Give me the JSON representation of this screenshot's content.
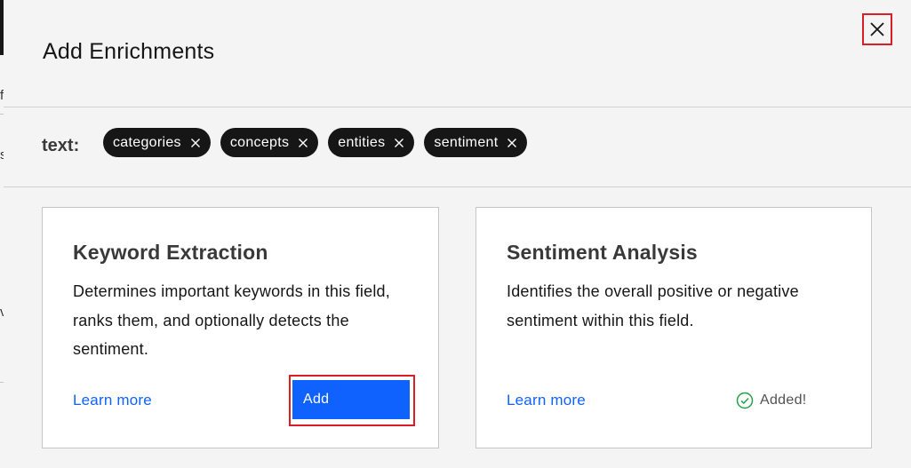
{
  "modal": {
    "title": "Add Enrichments",
    "close_icon": "close-icon"
  },
  "field": {
    "label": "text:",
    "tags": [
      {
        "label": "categories"
      },
      {
        "label": "concepts"
      },
      {
        "label": "entities"
      },
      {
        "label": "sentiment"
      }
    ]
  },
  "cards": [
    {
      "title": "Keyword Extraction",
      "description": "Determines important keywords in this field, ranks them, and optionally detects the sentiment.",
      "learn_more": "Learn more",
      "action_label": "Add"
    },
    {
      "title": "Sentiment Analysis",
      "description": "Identifies the overall positive or negative sentiment within this field.",
      "learn_more": "Learn more",
      "status_label": "Added!",
      "status_icon": "checkmark-outline-icon"
    }
  ],
  "background": {
    "glyphs": [
      "f",
      "s",
      "v"
    ]
  },
  "colors": {
    "accent": "#0f62fe",
    "tag_bg": "#161616",
    "highlight": "#da1e28",
    "success": "#24a148"
  }
}
